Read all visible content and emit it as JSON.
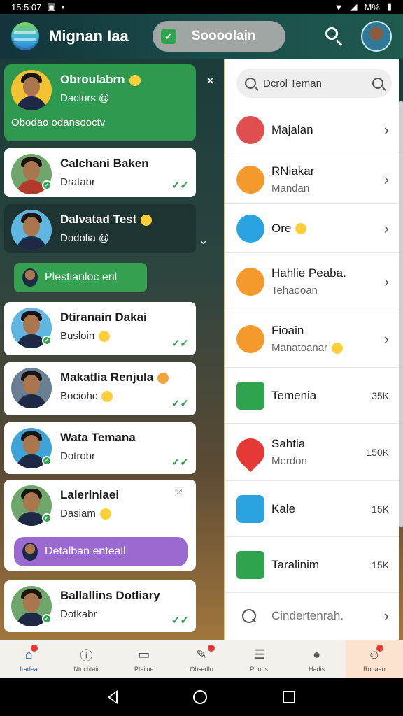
{
  "status_bar": {
    "time": "15:5:07",
    "carrier": "M%"
  },
  "header": {
    "app_title": "Mignan Iaa",
    "pill_label": "Soooolain"
  },
  "conversations": [
    {
      "name": "Obroulabrn",
      "subtitle": "Daclors @",
      "extra": "Obodao odansooctv",
      "style": "green"
    },
    {
      "name": "Calchani Baken",
      "subtitle": "Dratabr",
      "style": "white"
    },
    {
      "name": "Dalvatad Test",
      "subtitle": "Dodolia @",
      "style": "dark"
    },
    {
      "name": "Dtiranain Dakai",
      "subtitle": "Busloin",
      "style": "white"
    },
    {
      "name": "Makatlia Renjula",
      "subtitle": "Bociohc",
      "style": "white"
    },
    {
      "name": "Wata Temana",
      "subtitle": "Dotrobr",
      "style": "white"
    },
    {
      "name": "Lalerlniaei",
      "subtitle": "Dasiam",
      "style": "white"
    },
    {
      "name": "Ballallins Dotliary",
      "subtitle": "Dotkabr",
      "style": "white"
    }
  ],
  "bubbles": {
    "green": "Plestianloc enl",
    "purple": "Detalban enteall"
  },
  "panel": {
    "search_placeholder": "Dcrol Teman",
    "items": [
      {
        "title": "Majalan",
        "subtitle": "",
        "right": "›",
        "icon_color": "#e04f4f"
      },
      {
        "title": "RNiakar",
        "subtitle": "Mandan",
        "right": "›",
        "icon_color": "#f49a2c"
      },
      {
        "title": "Ore",
        "subtitle": "",
        "right": "›",
        "icon_color": "#2aa3e0"
      },
      {
        "title": "Hahlie Peaba.",
        "subtitle": "Tehaooan",
        "right": "›",
        "icon_color": "#f49a2c"
      },
      {
        "title": "Fioain",
        "subtitle": "Manatoanar",
        "right": "›",
        "icon_color": "#f49a2c"
      },
      {
        "title": "Temenia",
        "subtitle": "",
        "right": "35K",
        "icon_color": "#2ea44f"
      },
      {
        "title": "Sahtia",
        "subtitle": "Merdon",
        "right": "150K",
        "icon_color": "#e53935"
      },
      {
        "title": "Kale",
        "subtitle": "",
        "right": "15K",
        "icon_color": "#2aa3e0"
      },
      {
        "title": "Taralinim",
        "subtitle": "",
        "right": "15K",
        "icon_color": "#2ea44f"
      },
      {
        "title": "Cindertenrah.",
        "subtitle": "",
        "right": "›",
        "icon_color": "#555555"
      }
    ]
  },
  "bottom_nav": [
    {
      "label": "Iradea",
      "glyph": "⌂",
      "icon": "home-icon"
    },
    {
      "label": "Ntochtair",
      "glyph": "ⓘ",
      "icon": "info-icon"
    },
    {
      "label": "Ptaiioe",
      "glyph": "▭",
      "icon": "screen-icon"
    },
    {
      "label": "Obsedlo",
      "glyph": "✎",
      "icon": "edit-icon"
    },
    {
      "label": "Poous",
      "glyph": "☰",
      "icon": "document-icon"
    },
    {
      "label": "Hadis",
      "glyph": "●",
      "icon": "person-icon"
    },
    {
      "label": "Ronaao",
      "glyph": "☺",
      "icon": "emoji-icon"
    }
  ],
  "colors": {
    "accent_green": "#2ea44f",
    "bubble_purple": "#9b6ad1",
    "header_bg": "#1b4d4a"
  }
}
